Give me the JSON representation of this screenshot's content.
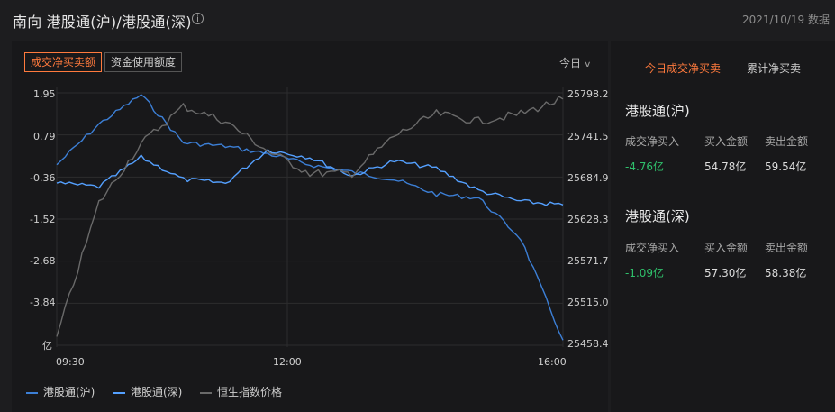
{
  "header": {
    "title": "南向 港股通(沪)/港股通(深)",
    "info_icon": "info-icon",
    "date": "2021/10/19 数据"
  },
  "chart": {
    "tabs": [
      {
        "label": "成交净买卖额",
        "active": true
      },
      {
        "label": "资金使用额度",
        "active": false
      }
    ],
    "period_label": "今日",
    "left_ticks": [
      "1.95",
      "0.79",
      "-0.36",
      "-1.52",
      "-2.68",
      "-3.84",
      "亿"
    ],
    "right_ticks": [
      "25798.2",
      "25741.5",
      "25684.9",
      "25628.3",
      "25571.7",
      "25515.0",
      "25458.4"
    ],
    "x_ticks": [
      "09:30",
      "12:00",
      "16:00"
    ],
    "legend": [
      {
        "name": "港股通(沪)",
        "color": "#3c7fd6"
      },
      {
        "name": "港股通(深)",
        "color": "#54a0ff"
      },
      {
        "name": "恒生指数价格",
        "color": "#6a6a6a"
      }
    ]
  },
  "chart_data": {
    "type": "line",
    "x": [
      "09:30",
      "10:00",
      "10:30",
      "11:00",
      "11:30",
      "12:00",
      "13:00",
      "13:30",
      "14:00",
      "14:30",
      "15:00",
      "15:30",
      "16:00"
    ],
    "ylim_left": [
      -4.9,
      1.95
    ],
    "ylim_right": [
      25458.4,
      25798.2
    ],
    "series": [
      {
        "name": "港股通(沪)",
        "axis": "left",
        "values": [
          0.0,
          1.1,
          1.9,
          0.6,
          0.5,
          0.3,
          0.0,
          -0.2,
          -0.4,
          -0.8,
          -0.9,
          -2.0,
          -4.76
        ]
      },
      {
        "name": "港股通(深)",
        "axis": "left",
        "values": [
          -0.5,
          -0.6,
          0.2,
          -0.4,
          -0.5,
          0.4,
          0.2,
          -0.3,
          0.1,
          -0.1,
          -0.7,
          -1.0,
          -1.09
        ]
      },
      {
        "name": "恒生指数价格",
        "axis": "right",
        "values": [
          25470,
          25650,
          25730,
          25780,
          25760,
          25720,
          25690,
          25690,
          25740,
          25770,
          25760,
          25770,
          25790
        ]
      }
    ]
  },
  "right": {
    "tabs": [
      {
        "label": "今日成交净买卖",
        "active": true
      },
      {
        "label": "累计净买卖",
        "active": false
      }
    ],
    "sections": [
      {
        "title": "港股通(沪)",
        "headers": [
          "成交净买入",
          "买入金额",
          "卖出金额"
        ],
        "values": [
          "-4.76亿",
          "54.78亿",
          "59.54亿"
        ]
      },
      {
        "title": "港股通(深)",
        "headers": [
          "成交净买入",
          "买入金额",
          "卖出金额"
        ],
        "values": [
          "-1.09亿",
          "57.30亿",
          "58.38亿"
        ]
      }
    ]
  },
  "colors": {
    "accent": "#ff7a3d",
    "positive_green": "#2fc06b",
    "line_sh": "#3c7fd6",
    "line_sz": "#54a0ff",
    "line_hsi": "#6a6a6a"
  }
}
